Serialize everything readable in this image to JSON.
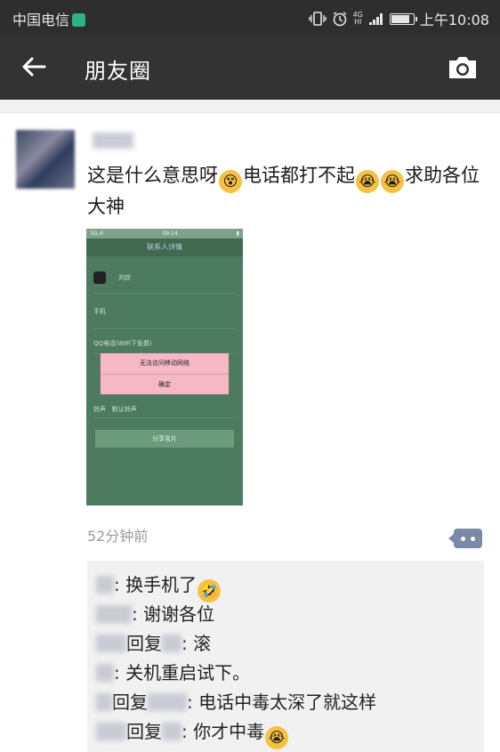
{
  "status_bar": {
    "carrier": "中国电信",
    "network_top": "4G",
    "network_bottom": "Hl",
    "time": "上午10:08",
    "battery_level": 0.85
  },
  "nav": {
    "title": "朋友圈",
    "back_icon": "arrow-left-icon",
    "camera_icon": "camera-icon"
  },
  "post": {
    "text_1": "这是什么意思呀",
    "text_2": "电话都打不起",
    "text_3": "求助各位大神",
    "time": "52分钟前",
    "screenshot": {
      "status_left": "3G.ıll",
      "status_time": "09:14",
      "header": "联系人详情",
      "row_name": "刘欢",
      "row_phone_label": "手机",
      "row_qq": "QQ电话(WiFi下免费)",
      "row_ring_label": "铃声",
      "row_ring_value": "默认铃声",
      "button": "分享名片",
      "dialog_message": "无法访问移动网络",
      "dialog_ok": "确定"
    }
  },
  "comments": [
    {
      "sep": ": ",
      "text": "换手机了"
    },
    {
      "sep": ": ",
      "text": "谢谢各位"
    },
    {
      "reply": "回复",
      "sep": ": ",
      "text": "滚"
    },
    {
      "sep": ": ",
      "text": "关机重启试下。"
    },
    {
      "reply": "回复",
      "sep": ": ",
      "text": "电话中毒太深了就这样"
    },
    {
      "reply": "回复",
      "sep": ": ",
      "text": "你才中毒"
    }
  ],
  "colors": {
    "status_bg": "#2e2e2e",
    "nav_bg": "#333333",
    "comment_bg": "#f1f1f1",
    "more_button": "#7c88a8"
  }
}
